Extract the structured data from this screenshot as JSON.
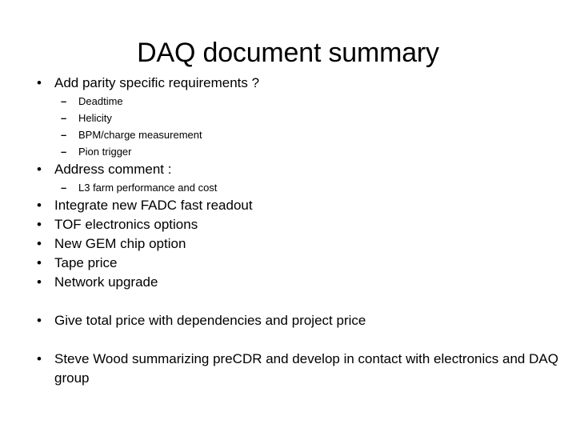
{
  "slide": {
    "title": "DAQ document summary",
    "background_color": "#ffffff",
    "text_color": "#000000",
    "blocks": [
      {
        "level": 1,
        "marker": "•",
        "text": "Add parity specific requirements ?"
      },
      {
        "level": 2,
        "marker": "–",
        "text": "Deadtime"
      },
      {
        "level": 2,
        "marker": "–",
        "text": "Helicity"
      },
      {
        "level": 2,
        "marker": "–",
        "text": "BPM/charge measurement"
      },
      {
        "level": 2,
        "marker": "–",
        "text": "Pion trigger"
      },
      {
        "level": 1,
        "marker": "•",
        "text": "Address comment :"
      },
      {
        "level": 2,
        "marker": "–",
        "text": "L3 farm performance and cost"
      },
      {
        "level": 1,
        "marker": "•",
        "text": "Integrate new FADC fast readout"
      },
      {
        "level": 1,
        "marker": "•",
        "text": "TOF electronics options"
      },
      {
        "level": 1,
        "marker": "•",
        "text": "New GEM chip option"
      },
      {
        "level": 1,
        "marker": "•",
        "text": "Tape price"
      },
      {
        "level": 1,
        "marker": "•",
        "text": "Network upgrade"
      },
      {
        "level": 0,
        "marker": "",
        "text": ""
      },
      {
        "level": 1,
        "marker": "•",
        "text": "Give total price with dependencies and project price"
      },
      {
        "level": 0,
        "marker": "",
        "text": ""
      },
      {
        "level": 1,
        "marker": "•",
        "text": "Steve Wood summarizing preCDR and develop in contact with electronics and DAQ group"
      }
    ]
  }
}
